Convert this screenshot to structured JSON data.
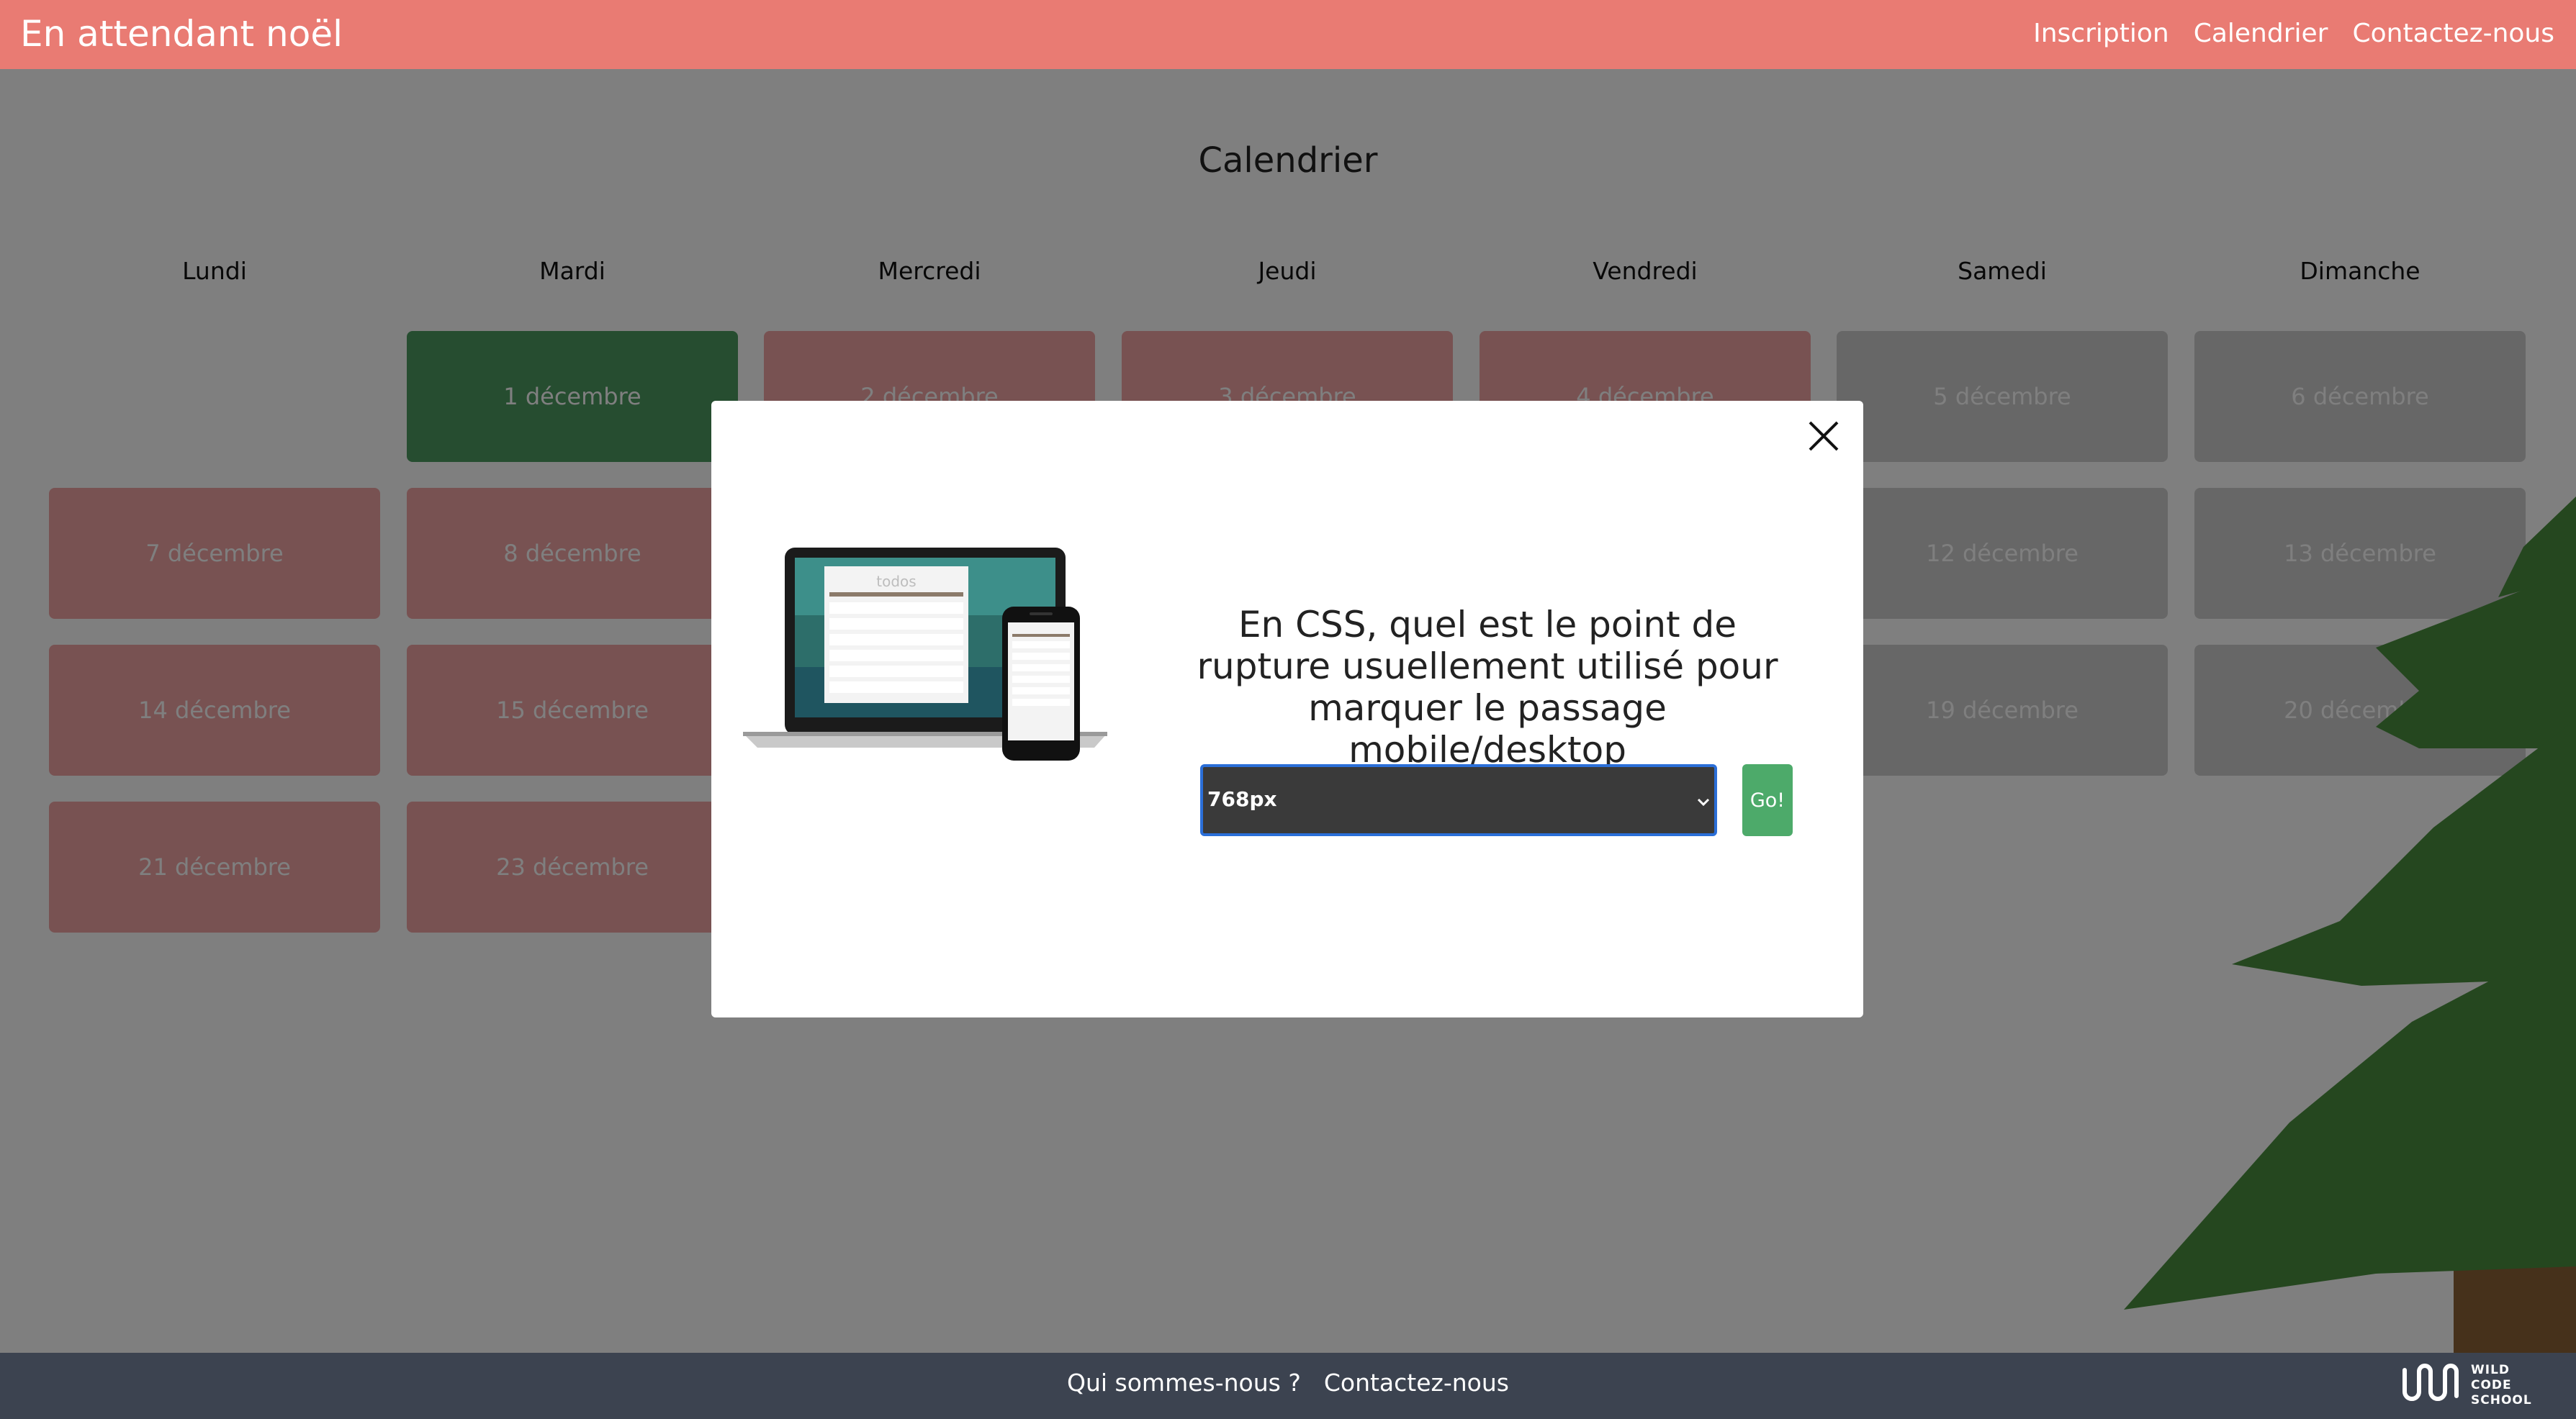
{
  "header": {
    "brand": "En attendant noël",
    "nav": [
      "Inscription",
      "Calendrier",
      "Contactez-nous"
    ]
  },
  "calendar": {
    "title": "Calendrier",
    "weekdays": [
      "Lundi",
      "Mardi",
      "Mercredi",
      "Jeudi",
      "Vendredi",
      "Samedi",
      "Dimanche"
    ],
    "days": {
      "d1": "1 décembre",
      "d2": "2 décembre",
      "d3": "3 décembre",
      "d4": "4 décembre",
      "d5": "5 décembre",
      "d6": "6 décembre",
      "d7": "7 décembre",
      "d8": "8 décembre",
      "d12": "12 décembre",
      "d13": "13 décembre",
      "d14": "14 décembre",
      "d15": "15 décembre",
      "d19": "19 décembre",
      "d20": "20 décembre",
      "d21": "21 décembre",
      "d23": "23 décembre"
    },
    "colors": {
      "past": "#4d9a60",
      "future": "#f0a5a5",
      "weekend": "#cfcfcf"
    }
  },
  "modal": {
    "question": "En CSS, quel est le point de rupture usuellement utilisé pour marquer le passage mobile/desktop",
    "select_value": "768px",
    "go_label": "Go!",
    "screen_app_title": "todos"
  },
  "footer": {
    "links": [
      "Qui sommes-nous ?",
      "Contactez-nous"
    ],
    "logo_lines": [
      "WILD",
      "CODE",
      "SCHOOL"
    ]
  },
  "colors": {
    "header": "#e97b73",
    "footer": "#3c4350",
    "go": "#4daa6a",
    "select_border": "#2b6fd8"
  }
}
